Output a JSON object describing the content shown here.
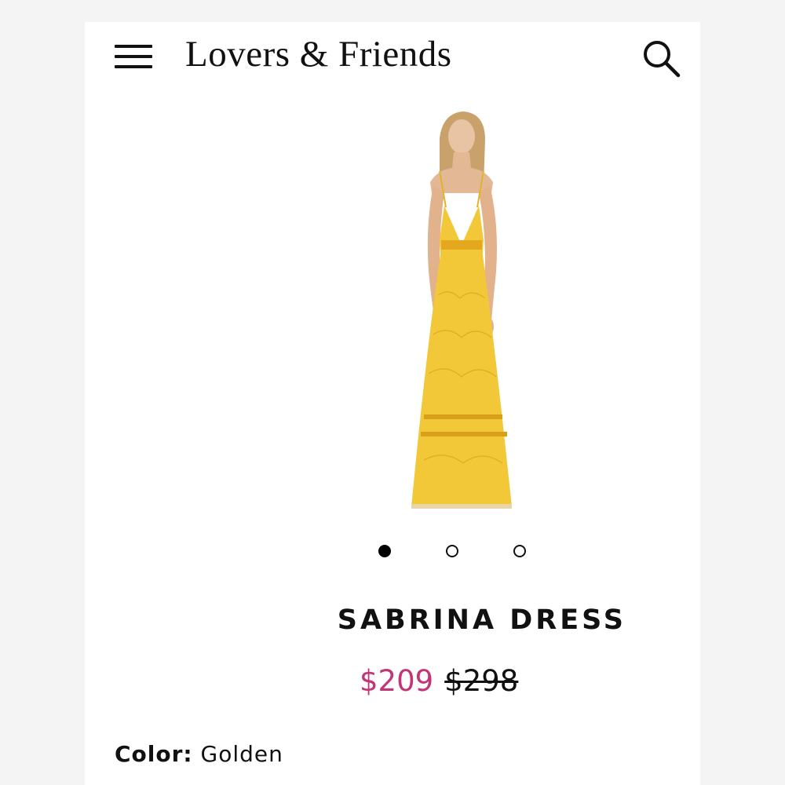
{
  "header": {
    "brand": "Lovers & Friends",
    "menu_icon": "hamburger-menu-icon",
    "search_icon": "search-icon"
  },
  "gallery": {
    "image_description": "model wearing yellow lace maxi dress",
    "dress_color": "#f2c838",
    "slide_count": 3,
    "active_slide": 1
  },
  "product": {
    "name": "SABRINA DRESS",
    "sale_price": "$209",
    "original_price": "$298",
    "sale_color": "#c23576",
    "color_label": "Color:",
    "color_value": "Golden"
  }
}
